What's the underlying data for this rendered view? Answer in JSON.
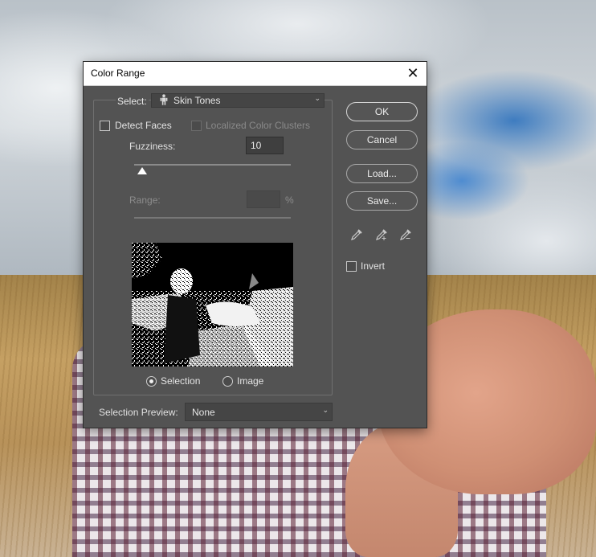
{
  "dialog": {
    "title": "Color Range",
    "select": {
      "label": "Select:",
      "value": "Skin Tones",
      "icon": "person-icon"
    },
    "detect_faces": {
      "label": "Detect Faces",
      "checked": false
    },
    "localized_clusters": {
      "label": "Localized Color Clusters",
      "checked": false,
      "enabled": false
    },
    "fuzziness": {
      "label": "Fuzziness:",
      "value": "10"
    },
    "range": {
      "label": "Range:",
      "value": "",
      "unit": "%",
      "enabled": false
    },
    "preview_mode": {
      "selection_label": "Selection",
      "image_label": "Image",
      "selected": "Selection"
    },
    "selection_preview": {
      "label": "Selection Preview:",
      "value": "None"
    },
    "buttons": {
      "ok": "OK",
      "cancel": "Cancel",
      "load": "Load...",
      "save": "Save..."
    },
    "eyedroppers": [
      "eyedropper-icon",
      "eyedropper-add-icon",
      "eyedropper-subtract-icon"
    ],
    "invert": {
      "label": "Invert",
      "checked": false
    }
  },
  "colors": {
    "dialog_bg": "#535353",
    "titlebar_bg": "#ffffff",
    "text": "#dcdcdc"
  }
}
